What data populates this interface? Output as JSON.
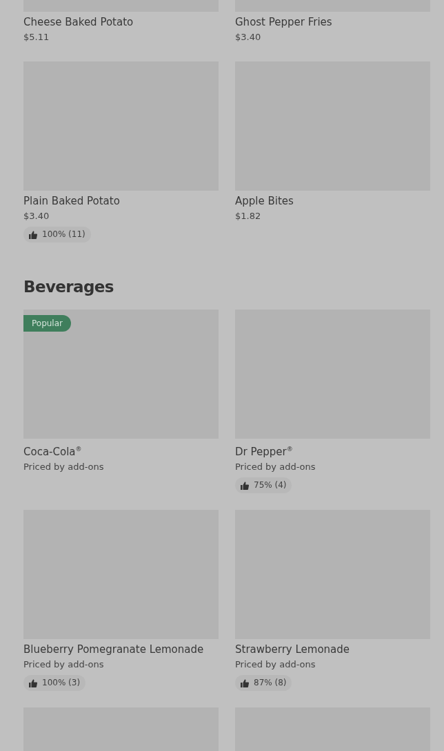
{
  "sections": [
    {
      "items": [
        {
          "kind": "product",
          "name": "Cheese Baked Potato",
          "price": "$5.11"
        },
        {
          "kind": "product",
          "name": "Ghost Pepper Fries",
          "price": "$3.40"
        },
        {
          "kind": "product",
          "name": "Plain Baked Potato",
          "price": "$3.40",
          "rating": "100% (11)"
        },
        {
          "kind": "product",
          "name": "Apple Bites",
          "price": "$1.82"
        }
      ]
    },
    {
      "title": "Beverages",
      "items": [
        {
          "kind": "product",
          "name": "Coca-Cola$^{®}$",
          "price": "Priced by add-ons",
          "badge": "Popular"
        },
        {
          "kind": "product",
          "name": "Dr Pepper$^{®}$",
          "price": "Priced by add-ons",
          "rating": "75% (4)"
        },
        {
          "kind": "product",
          "name": "Blueberry Pomegranate Lemonade",
          "price": "Priced by add-ons",
          "rating": "100% (3)"
        },
        {
          "kind": "product",
          "name": "Strawberry Lemonade",
          "price": "Priced by add-ons",
          "rating": "87% (8)"
        },
        {
          "kind": "image-only"
        },
        {
          "kind": "image-only"
        }
      ]
    }
  ]
}
